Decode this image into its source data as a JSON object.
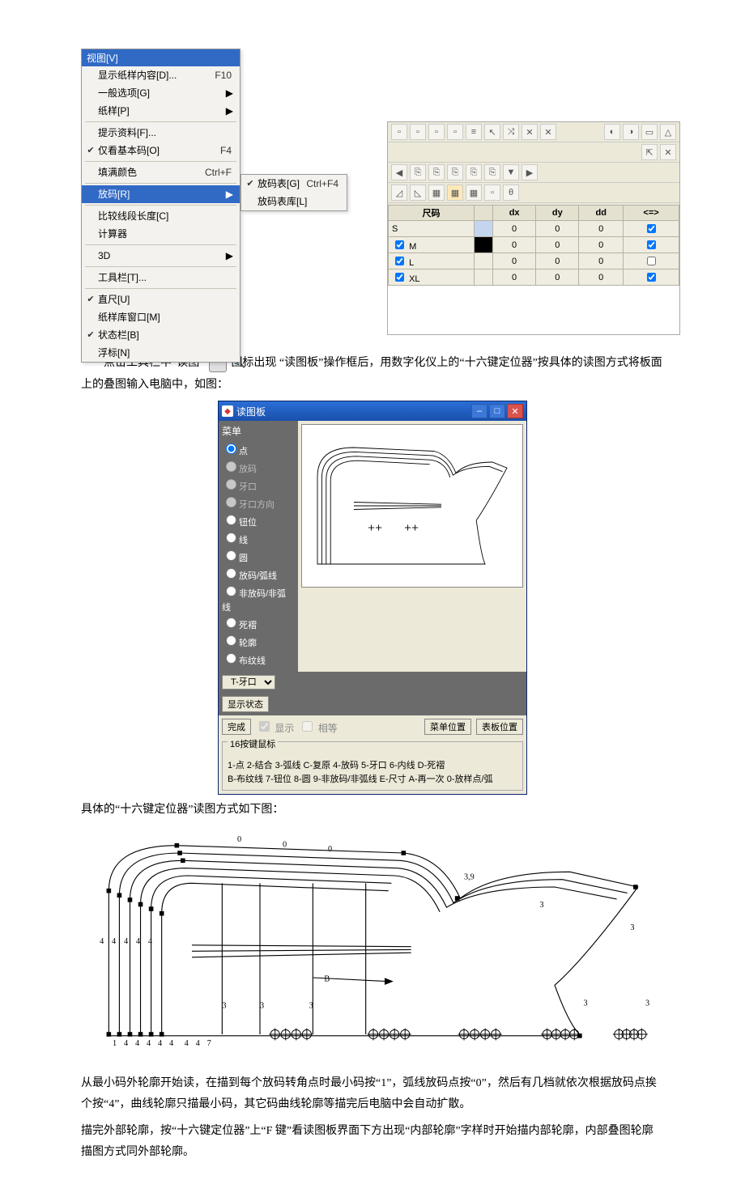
{
  "menu": {
    "title": "视图[V]",
    "items": [
      {
        "label": "显示纸样内容[D]...",
        "shortcut": "F10",
        "check": "",
        "arrow": ""
      },
      {
        "label": "一般选项[G]",
        "shortcut": "",
        "check": "",
        "arrow": "▶"
      },
      {
        "label": "纸样[P]",
        "shortcut": "",
        "check": "",
        "arrow": "▶"
      }
    ],
    "items2": [
      {
        "label": "提示资料[F]...",
        "shortcut": "",
        "check": "",
        "arrow": ""
      },
      {
        "label": "仅看基本码[O]",
        "shortcut": "F4",
        "check": "✔",
        "arrow": ""
      }
    ],
    "items3": [
      {
        "label": "填满颜色",
        "shortcut": "Ctrl+F",
        "check": "",
        "arrow": ""
      }
    ],
    "items4": [
      {
        "label": "放码[R]",
        "shortcut": "",
        "check": "",
        "arrow": "▶",
        "hl": true
      }
    ],
    "items5": [
      {
        "label": "比较线段长度[C]",
        "shortcut": "",
        "check": "",
        "arrow": ""
      },
      {
        "label": "计算器",
        "shortcut": "",
        "check": "",
        "arrow": ""
      }
    ],
    "items6": [
      {
        "label": "3D",
        "shortcut": "",
        "check": "",
        "arrow": "▶"
      }
    ],
    "items7": [
      {
        "label": "工具栏[T]...",
        "shortcut": "",
        "check": "",
        "arrow": ""
      }
    ],
    "items8": [
      {
        "label": "直尺[U]",
        "shortcut": "",
        "check": "✔",
        "arrow": ""
      },
      {
        "label": "纸样库窗口[M]",
        "shortcut": "",
        "check": "",
        "arrow": ""
      },
      {
        "label": "状态栏[B]",
        "shortcut": "",
        "check": "✔",
        "arrow": ""
      },
      {
        "label": "浮标[N]",
        "shortcut": "",
        "check": "",
        "arrow": ""
      }
    ],
    "submenu": [
      {
        "label": "放码表[G]",
        "shortcut": "Ctrl+F4",
        "check": "✔"
      },
      {
        "label": "放码表库[L]",
        "shortcut": "",
        "check": ""
      }
    ]
  },
  "sizetable": {
    "headers": [
      "尺码",
      "dx",
      "dy",
      "dd",
      "<=>"
    ],
    "rows": [
      {
        "size": "S",
        "dx": "0",
        "dy": "0",
        "dd": "0",
        "flag": true
      },
      {
        "size": "M",
        "dx": "0",
        "dy": "0",
        "dd": "0",
        "flag": true,
        "chk": true
      },
      {
        "size": "L",
        "dx": "0",
        "dy": "0",
        "dd": "0",
        "flag": false,
        "chk": true
      },
      {
        "size": "XL",
        "dx": "0",
        "dy": "0",
        "dd": "0",
        "flag": true,
        "chk": true
      }
    ]
  },
  "text": {
    "p1a": "点击工具栏中“读图”",
    "p1b": "图标出现 “读图板”操作框后，用数字化仪上的“十六键定位器”按具体的读图方式将板面上的叠图输入电脑中，如图：",
    "p2": "具体的“十六键定位器”读图方式如下图：",
    "p3": "从最小码外轮廓开始读，在描到每个放码转角点时最小码按“1”，弧线放码点按“0”，然后有几档就依次根据放码点挨个按“4”，曲线轮廓只描最小码，其它码曲线轮廓等描完后电脑中会自动扩散。",
    "p4": "描完外部轮廓，按“十六键定位器”上“F 键”看读图板界面下方出现“内部轮廓”字样时开始描内部轮廓，内部叠图轮廓描图方式同外部轮廓。"
  },
  "dialog": {
    "title": "读图板",
    "menu_header": "菜单",
    "radios": [
      "点",
      "放码",
      "牙口",
      "牙口方向",
      "钮位",
      "线",
      "圆",
      "放码/弧线",
      "非放码/非弧线",
      "死褶",
      "轮廓",
      "布纹线"
    ],
    "selected_radio": 0,
    "dropdown": "T-牙口",
    "btn_show_state": "显示状态",
    "btn_done": "完成",
    "chk_show": "显示",
    "chk_equal": "相等",
    "btn_menu_pos": "菜单位置",
    "btn_panel_pos": "表板位置",
    "legend_title": "16按键鼠标",
    "legend_line1": "1-点   2-结合   3-弧线   C-复原   4-放码   5-牙口   6-内线   D-死褶",
    "legend_line2": "B-布纹线   7-钮位   8-圆   9-非放码/非弧线   E-尺寸   A-再一次  0-放样点/弧"
  },
  "icon_glyph": "🔍"
}
